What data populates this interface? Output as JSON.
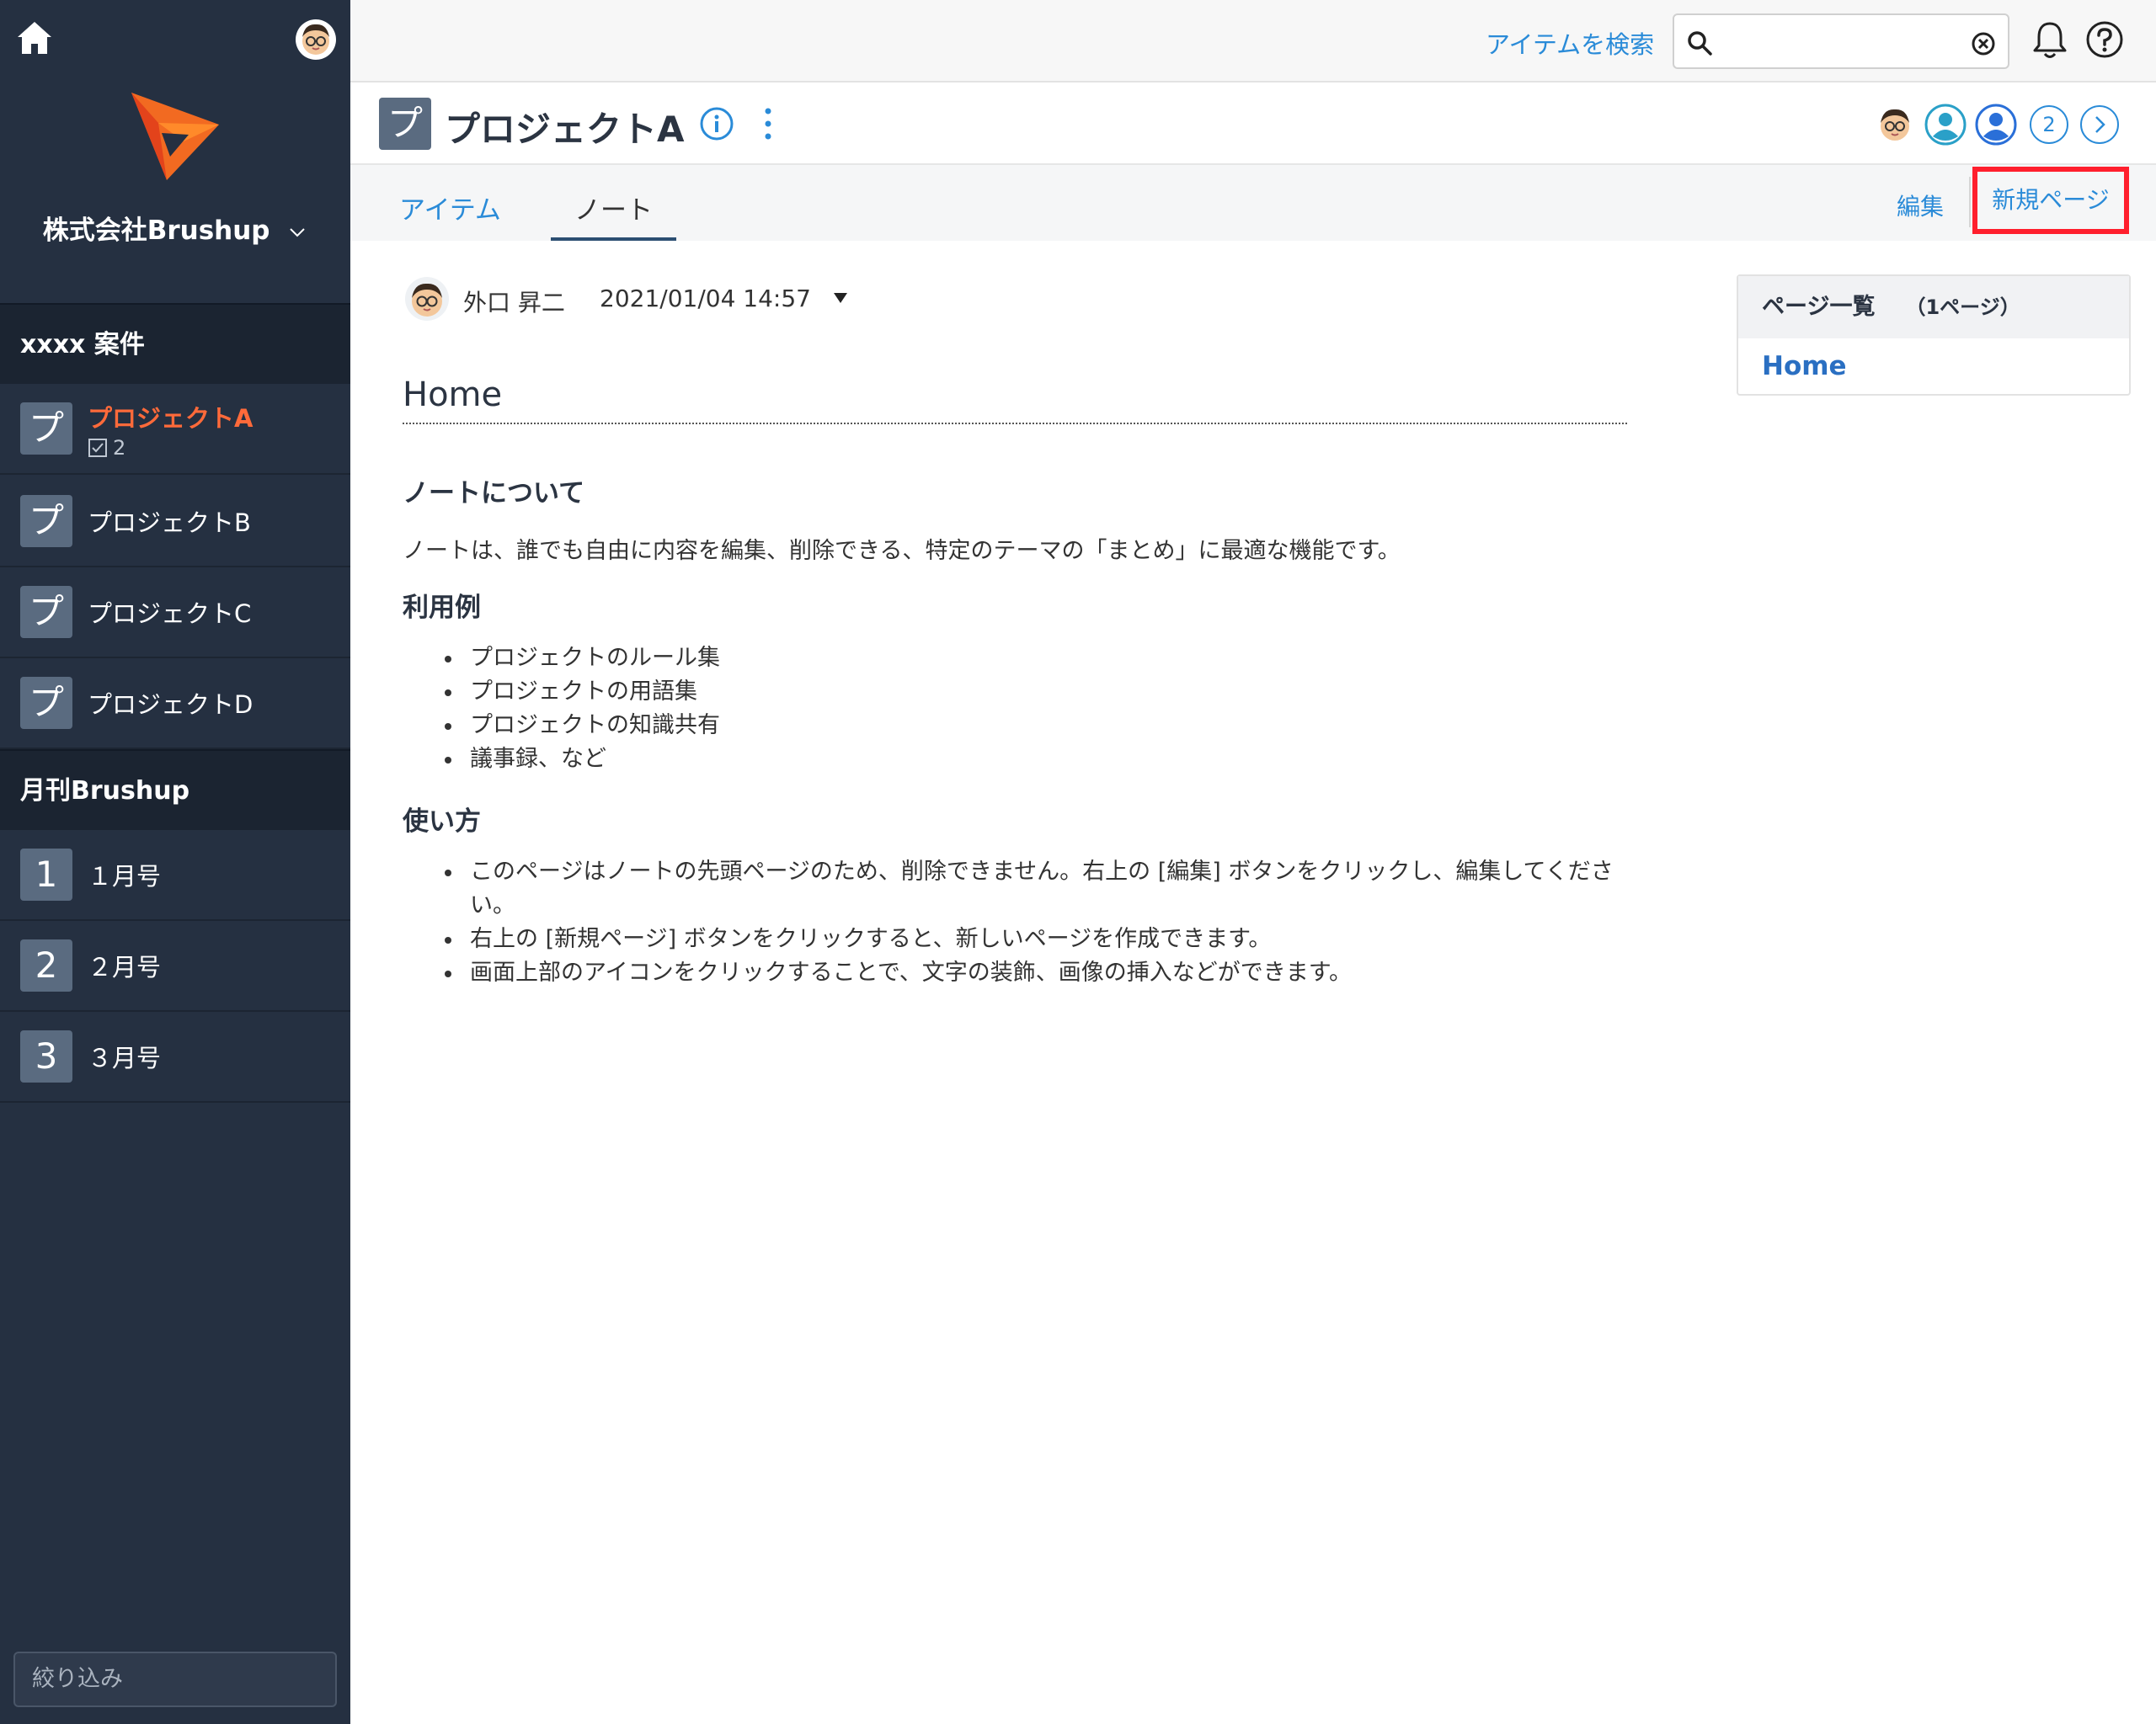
{
  "sidebar": {
    "company": "株式会社Brushup",
    "groups": [
      {
        "title": "xxxx 案件",
        "items": [
          {
            "icon": "プ",
            "label": "プロジェクトA",
            "task_count": "2"
          },
          {
            "icon": "プ",
            "label": "プロジェクトB"
          },
          {
            "icon": "プ",
            "label": "プロジェクトC"
          },
          {
            "icon": "プ",
            "label": "プロジェクトD"
          }
        ]
      },
      {
        "title": "月刊Brushup",
        "items": [
          {
            "icon": "1",
            "label": "１月号"
          },
          {
            "icon": "2",
            "label": "２月号"
          },
          {
            "icon": "3",
            "label": "３月号"
          }
        ]
      }
    ],
    "filter_placeholder": "絞り込み"
  },
  "topbar": {
    "search_label": "アイテムを検索",
    "search_value": ""
  },
  "project": {
    "icon": "プ",
    "title": "プロジェクトA",
    "member_count": "2"
  },
  "tabs": [
    {
      "label": "アイテム",
      "active": false
    },
    {
      "label": "ノート",
      "active": true
    }
  ],
  "actions": {
    "edit": "編集",
    "new_page": "新規ページ"
  },
  "note": {
    "author": "外口 昇二",
    "date": "2021/01/04 14:57",
    "title": "Home",
    "about_heading": "ノートについて",
    "about_text": "ノートは、誰でも自由に内容を編集、削除できる、特定のテーマの「まとめ」に最適な機能です。",
    "use_heading": "利用例",
    "use_items": [
      "プロジェクトのルール集",
      "プロジェクトの用語集",
      "プロジェクトの知識共有",
      "議事録、など"
    ],
    "how_heading": "使い方",
    "how_items": [
      "このページはノートの先頭ページのため、削除できません。右上の [編集] ボタンをクリックし、編集してください。",
      "右上の [新規ページ] ボタンをクリックすると、新しいページを作成できます。",
      "画面上部のアイコンをクリックすることで、文字の装飾、画像の挿入などができます。"
    ]
  },
  "page_list": {
    "title": "ページ一覧",
    "count": "（1ページ）",
    "pages": [
      "Home"
    ]
  },
  "colors": {
    "sidebar_bg": "#253041",
    "accent_link": "#2a8bd8",
    "active_project": "#ff6a3a",
    "highlight_box": "#ff1f2d"
  },
  "icons": {
    "home": "home-icon",
    "bell": "bell-icon",
    "help": "help-icon",
    "search": "search-icon",
    "clear": "clear-icon",
    "info": "info-icon",
    "kebab": "kebab-icon"
  }
}
